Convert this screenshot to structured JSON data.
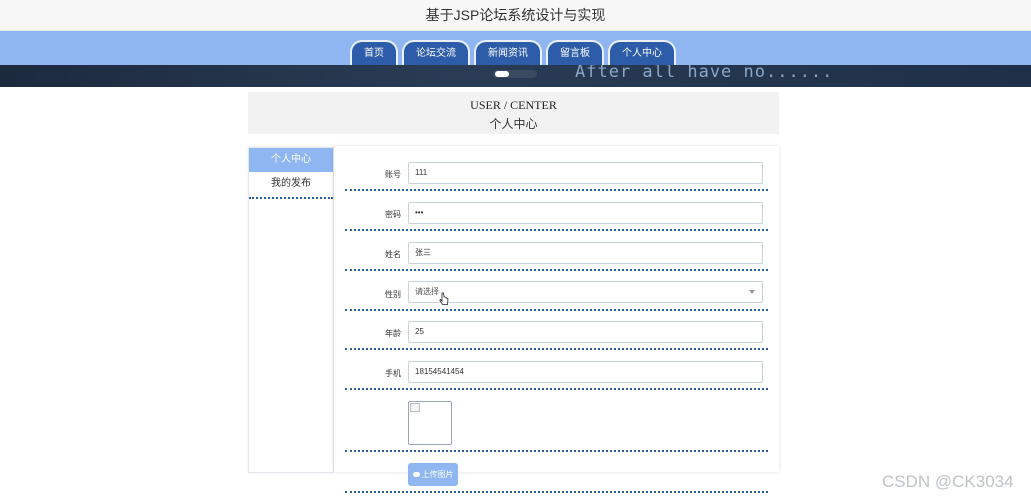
{
  "site": {
    "title": "基于JSP论坛系统设计与实现"
  },
  "nav": {
    "tabs": [
      {
        "label": "首页"
      },
      {
        "label": "论坛交流"
      },
      {
        "label": "新闻资讯"
      },
      {
        "label": "留言板"
      },
      {
        "label": "个人中心"
      }
    ]
  },
  "banner": {
    "text": "After all have no......"
  },
  "header": {
    "title_en": "USER / CENTER",
    "title_zh": "个人中心"
  },
  "sidebar": {
    "items": [
      {
        "label": "个人中心",
        "active": true
      },
      {
        "label": "我的发布",
        "active": false
      }
    ]
  },
  "form": {
    "account": {
      "label": "账号",
      "value": "111"
    },
    "password": {
      "label": "密码",
      "value": "•••"
    },
    "name": {
      "label": "姓名",
      "value": "张三"
    },
    "gender": {
      "label": "性别",
      "value": "请选择"
    },
    "age": {
      "label": "年龄",
      "value": "25"
    },
    "phone": {
      "label": "手机",
      "value": "18154541454"
    },
    "upload": {
      "label": "上传图片"
    }
  },
  "watermark": "CSDN @CK3034",
  "colors": {
    "accent": "#8fb6f0",
    "tab": "#2d5ca8",
    "banner": "#1c2a3e"
  }
}
